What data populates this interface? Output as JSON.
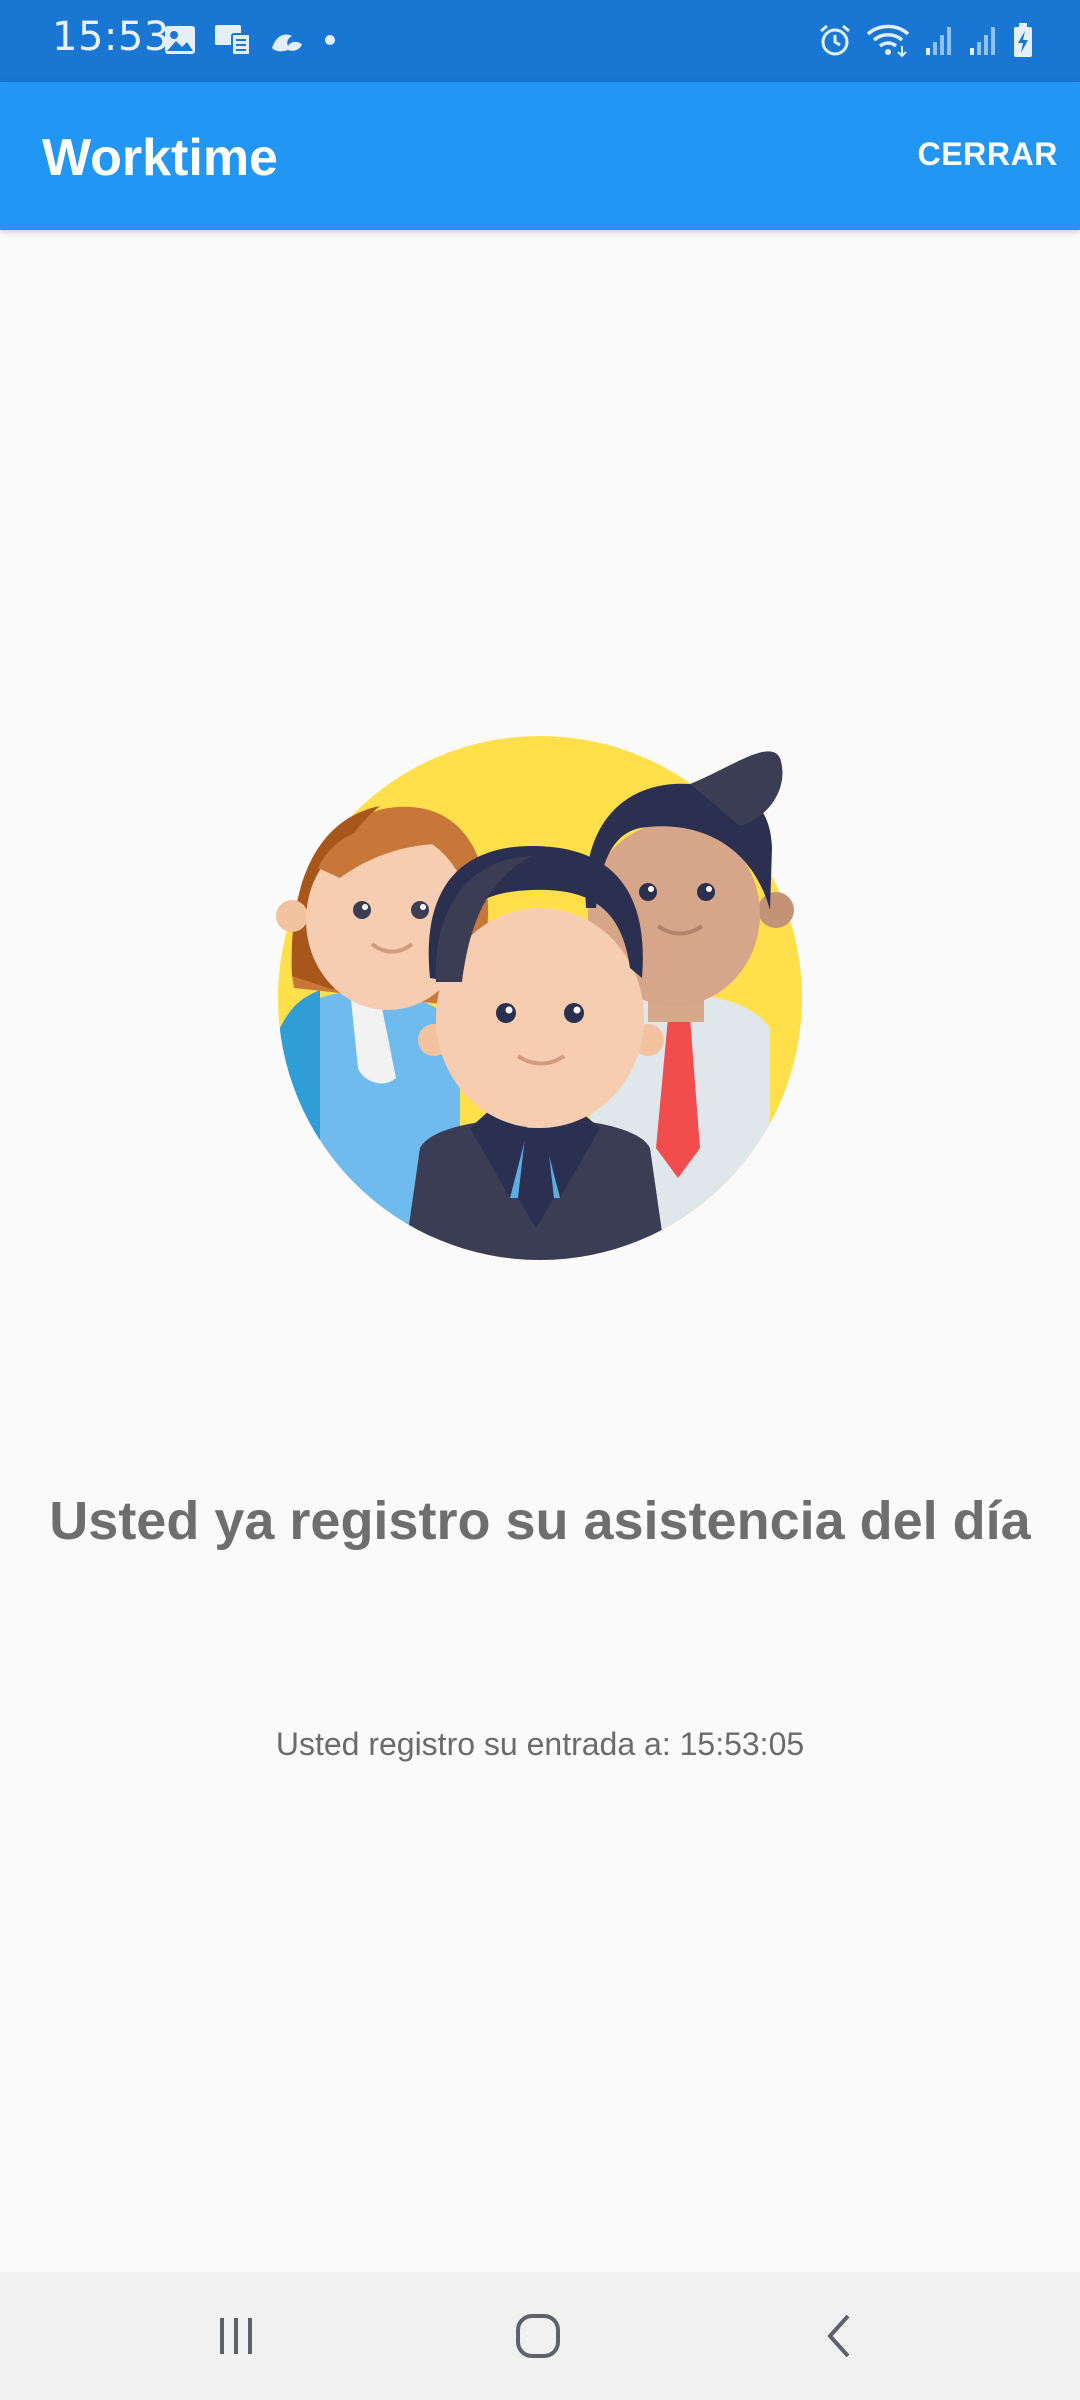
{
  "status_bar": {
    "time": "15:53",
    "left_icons": [
      "image-icon",
      "screen-cast-icon",
      "weather-icon",
      "dot-icon"
    ],
    "right_icons": [
      "alarm-icon",
      "wifi-icon",
      "signal-icon",
      "signal-icon",
      "battery-charging-icon"
    ],
    "background": "#1976d2"
  },
  "app_bar": {
    "title": "Worktime",
    "close_label": "CERRAR",
    "background": "#2196f3"
  },
  "illustration": {
    "icon": "team-people-illustration",
    "circle_color": "#ffe04a"
  },
  "main": {
    "headline": "Usted ya registro su asistencia del día",
    "entry_text": "Usted registro su entrada a: 15:53:05"
  },
  "nav_bar": {
    "buttons": [
      "recent-apps-icon",
      "home-icon",
      "back-icon"
    ]
  }
}
